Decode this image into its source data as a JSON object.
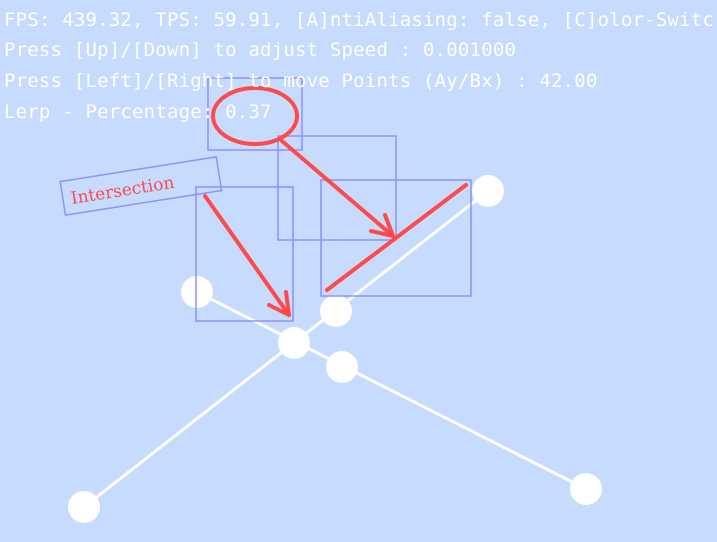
{
  "hud": {
    "line1": "FPS: 439.32, TPS: 59.91, [A]ntiAliasing: false, [C]olor-Switc",
    "line2": "Press [Up]/[Down] to adjust Speed : 0.001000",
    "line3": "Press [Left]/[Right] to move Points (Ay/Bx) : 42.00",
    "line4": "Lerp - Percentage: 0.37"
  },
  "annotation": {
    "label": "Intersection"
  },
  "colors": {
    "background": "#c6dbfe",
    "points": "#ffffff",
    "lines": "#ffffff",
    "highlight_boxes": "#8f8fff",
    "annotation_red": "#ff4a4a"
  }
}
